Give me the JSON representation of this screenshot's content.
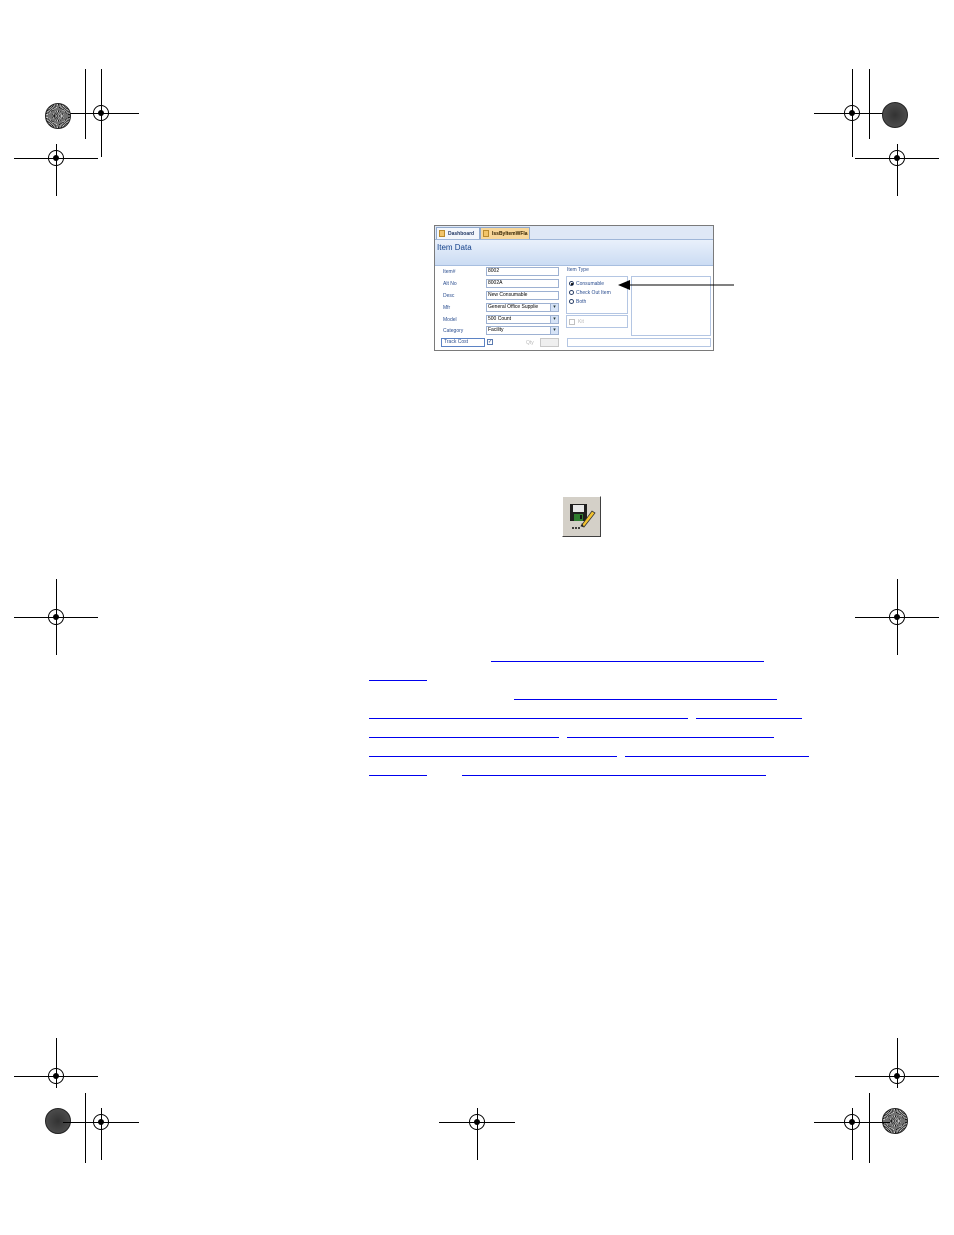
{
  "screenshot": {
    "tabs": [
      "Dashboard",
      "IssByItemWFla"
    ],
    "header_title": "Item Data",
    "fields": [
      {
        "label": "Item#",
        "value": "8002",
        "dropdown": false
      },
      {
        "label": "Alt No",
        "value": "8002A",
        "dropdown": false
      },
      {
        "label": "Desc",
        "value": "New Consumable",
        "dropdown": false
      },
      {
        "label": "Mfr",
        "value": "General Office Supplie",
        "dropdown": true
      },
      {
        "label": "Model",
        "value": "500 Count",
        "dropdown": true
      },
      {
        "label": "Category",
        "value": "Facility",
        "dropdown": true
      }
    ],
    "track_cost_label": "Track Cost",
    "qty_label": "Qty",
    "item_type_label": "Item Type",
    "item_type_options": [
      {
        "label": "Consumable",
        "selected": true
      },
      {
        "label": "Check Out Item",
        "selected": false
      },
      {
        "label": "Both",
        "selected": false
      }
    ],
    "kit_label": "Kit"
  },
  "save_button_icon": "save-and-edit-icon",
  "colors": {
    "link": "#0000ee",
    "header_text": "#15428b",
    "active_tab": "#f8d79a"
  }
}
